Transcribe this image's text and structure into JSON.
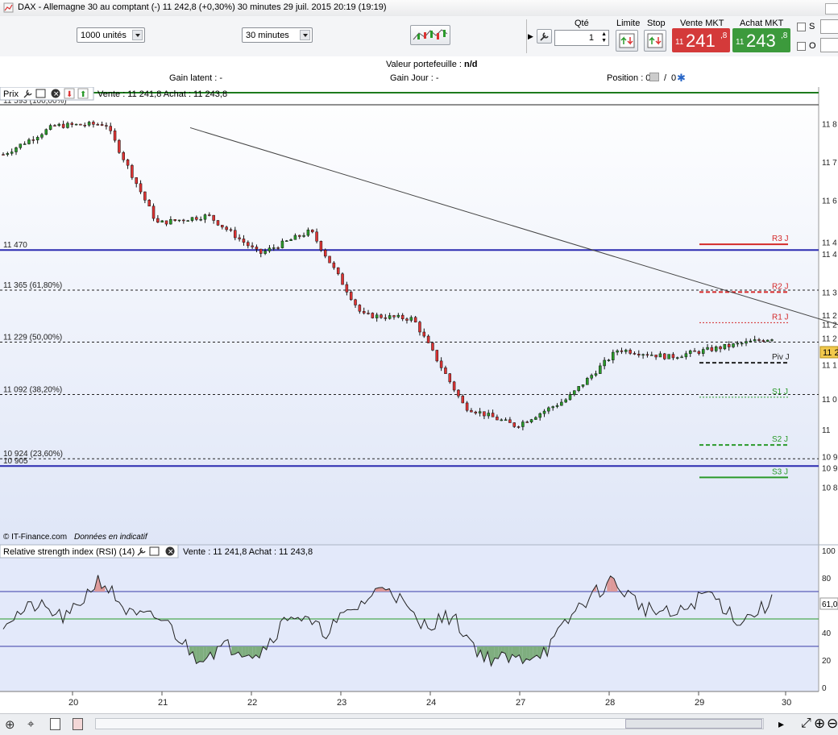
{
  "window": {
    "title": "DAX - Allemagne 30 au comptant (-)     11 242,8 (+0,30%)     30 minutes  29 juil. 2015 20:19 (19:19)"
  },
  "toolbar": {
    "quantity_select": "1000 unités",
    "period_select": "30 minutes",
    "qty_label": "Qté",
    "qty_value": "1",
    "limit_label": "Limite",
    "stop_label": "Stop",
    "sell_label": "Vente MKT",
    "buy_label": "Achat MKT",
    "sell_price_prefix": "11",
    "sell_price_main": "241",
    "sell_price_sup": ",8",
    "buy_price_prefix": "11",
    "buy_price_main": "243",
    "buy_price_sup": ",8",
    "check_s": "S",
    "check_o": "O",
    "colors": {
      "sell": "#d43a3a",
      "buy": "#3c9a3c"
    }
  },
  "info": {
    "portfolio_label": "Valeur portefeuille : ",
    "portfolio_value": "n/d",
    "latent_label": "Gain latent : -",
    "day_label": "Gain Jour : -",
    "position_label": "Position : 0",
    "position_sep": "/",
    "position_value2": "0"
  },
  "price_pane": {
    "header_label": "Prix",
    "header_quote": "Vente : 11 241,8 Achat : 11 243,8",
    "top_label_partial": "11 593 (100,00%)",
    "credit": "© IT-Finance.com",
    "credit_note": "Données en indicatif",
    "levels": [
      {
        "label": "11 470",
        "value": 11470,
        "style": "solid",
        "color": "#2b2bb0"
      },
      {
        "label": "11 365 (61,80%)",
        "value": 11365,
        "style": "dashed",
        "color": "#222"
      },
      {
        "label": "11 229 (50,00%)",
        "value": 11229,
        "style": "dashed",
        "color": "#222"
      },
      {
        "label": "11 092 (38,20%)",
        "value": 11092,
        "style": "dashed",
        "color": "#222"
      },
      {
        "label": "10 924 (23,60%)",
        "value": 10924,
        "style": "dashed",
        "color": "#222"
      },
      {
        "label": "10 905",
        "value": 10905,
        "style": "solid",
        "color": "#2b2bb0"
      }
    ],
    "pivots": [
      {
        "label": "R3 J",
        "value": 11485,
        "color": "#d42a2a",
        "style": "solid"
      },
      {
        "label": "R2 J",
        "value": 11360,
        "color": "#d42a2a",
        "style": "dashed"
      },
      {
        "label": "R1 J",
        "value": 11280,
        "color": "#d42a2a",
        "style": "dotted"
      },
      {
        "label": "Piv J",
        "value": 11175,
        "color": "#222",
        "style": "dashed"
      },
      {
        "label": "S1 J",
        "value": 11085,
        "color": "#2a9a2a",
        "style": "dotted"
      },
      {
        "label": "S2 J",
        "value": 10960,
        "color": "#2a9a2a",
        "style": "dashed"
      },
      {
        "label": "S3 J",
        "value": 10875,
        "color": "#2a9a2a",
        "style": "solid"
      }
    ],
    "right_axis_labels": [
      "11 8",
      "11 7",
      "11 6",
      "11 4",
      "11 4",
      "11 3",
      "11 2",
      "11 2",
      "11 2",
      "11 1",
      "11 1",
      "11 0",
      "11",
      "10 9",
      "10 9",
      "10 8"
    ],
    "current_price_tag": "11 2"
  },
  "rsi_pane": {
    "header_label": "Relative strength index (RSI) (14)",
    "header_quote": "Vente : 11 241,8 Achat : 11 243,8",
    "axis_labels": [
      "100",
      "80",
      "60",
      "40",
      "20",
      "0"
    ],
    "current_tag": "61,0",
    "overbought": 70,
    "oversold": 30,
    "mid": 50
  },
  "x_axis": {
    "labels": [
      "20",
      "21",
      "22",
      "23",
      "24",
      "27",
      "28",
      "29",
      "30"
    ]
  },
  "chart_data": {
    "type": "line",
    "title": "DAX - Allemagne 30 au comptant (-)",
    "xlabel": "",
    "ylabel": "",
    "x": [
      "20",
      "21",
      "22",
      "23",
      "24",
      "27",
      "28",
      "29",
      "30"
    ],
    "series": [
      {
        "values": [
          11720,
          11795,
          11800,
          11540,
          11560,
          11460,
          11520,
          11300,
          11290,
          11060,
          11010,
          11080,
          11210,
          11190,
          11215,
          11240
        ]
      }
    ],
    "ylim": [
      10800,
      11850
    ],
    "trendline": {
      "from": [
        "21",
        11790
      ],
      "to": [
        "30",
        11275
      ]
    }
  }
}
